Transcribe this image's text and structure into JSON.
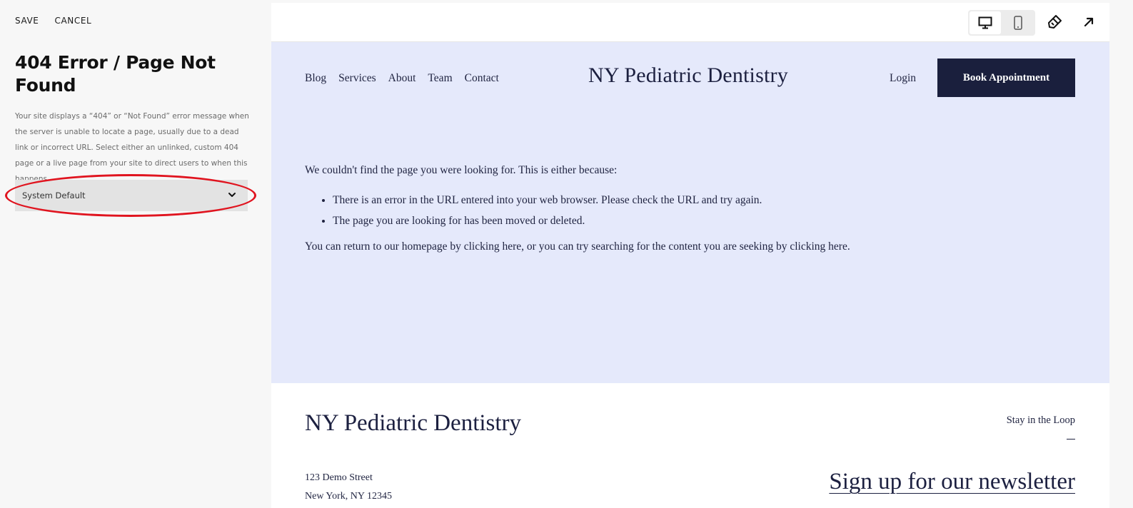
{
  "panel": {
    "save_label": "SAVE",
    "cancel_label": "CANCEL",
    "title": "404 Error / Page Not Found",
    "description": "Your site displays a “404” or “Not Found” error message when the server is unable to locate a page, usually due to a dead link or incorrect URL. Select either an unlinked, custom 404 page or a live page from your site to direct users to when this happens.",
    "select_value": "System Default"
  },
  "toolbar": {
    "icons": [
      "desktop-icon",
      "mobile-icon",
      "brush-icon",
      "expand-arrow-icon"
    ]
  },
  "site": {
    "nav": [
      "Blog",
      "Services",
      "About",
      "Team",
      "Contact"
    ],
    "logo": "NY Pediatric Dentistry",
    "login": "Login",
    "book": "Book Appointment",
    "content": {
      "intro": "We couldn't find the page you were looking for. This is either because:",
      "reasons": [
        "There is an error in the URL entered into your web browser. Please check the URL and try again.",
        "The page you are looking for has been moved or deleted."
      ],
      "return_text": "You can return to our homepage by clicking here, or you can try searching for the content you are seeking by clicking here."
    },
    "footer": {
      "logo": "NY Pediatric Dentistry",
      "address_line1": "123 Demo Street",
      "address_line2": "New York, NY 12345",
      "stay_label": "Stay in the Loop",
      "newsletter": "Sign up for our newsletter"
    }
  },
  "colors": {
    "annotation": "#e0141f",
    "band": "#e5e9fb",
    "button": "#1a1f3d"
  }
}
